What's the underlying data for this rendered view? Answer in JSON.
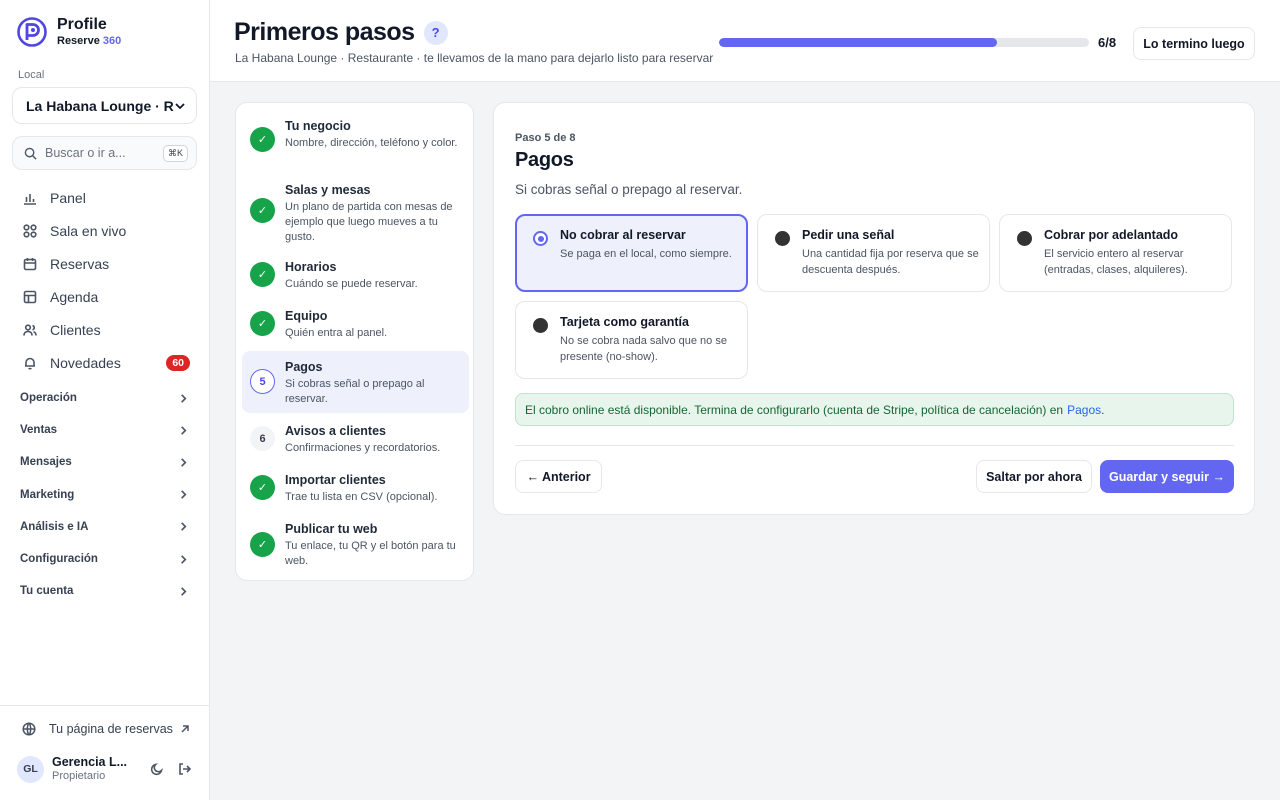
{
  "brand": {
    "name": "Profile",
    "product": "Reserve",
    "version": "360"
  },
  "sidebar": {
    "local_label": "Local",
    "local_value": "La Habana Lounge · Restaurante",
    "search_placeholder": "Buscar o ir a...",
    "search_shortcut": "⌘K",
    "nav": [
      {
        "label": "Panel",
        "icon": "bar-chart-icon"
      },
      {
        "label": "Sala en vivo",
        "icon": "grid-icon"
      },
      {
        "label": "Reservas",
        "icon": "calendar-icon"
      },
      {
        "label": "Agenda",
        "icon": "table-icon"
      },
      {
        "label": "Clientes",
        "icon": "users-icon"
      },
      {
        "label": "Novedades",
        "icon": "bell-icon",
        "badge": "60"
      }
    ],
    "groups": [
      "Operación",
      "Ventas",
      "Mensajes",
      "Marketing",
      "Análisis e IA",
      "Configuración",
      "Tu cuenta"
    ],
    "web_link": "Tu página de reservas",
    "user": {
      "initials": "GL",
      "name": "Gerencia L...",
      "role": "Propietario"
    }
  },
  "header": {
    "title": "Primeros pasos",
    "help": "?",
    "subtitle": "La Habana Lounge · Restaurante · te llevamos de la mano para dejarlo listo para reservar",
    "progress": 0.75,
    "progress_label": "6/8",
    "later_button": "Lo termino luego"
  },
  "steps": [
    {
      "status": "done",
      "marker": "✓",
      "title": "Tu negocio",
      "desc": "Nombre, dirección, teléfono y color."
    },
    {
      "status": "done",
      "marker": "✓",
      "title": "Salas y mesas",
      "desc": "Un plano de partida con mesas de ejemplo que luego mueves a tu gusto."
    },
    {
      "status": "done",
      "marker": "✓",
      "title": "Horarios",
      "desc": "Cuándo se puede reservar."
    },
    {
      "status": "done",
      "marker": "✓",
      "title": "Equipo",
      "desc": "Quién entra al panel."
    },
    {
      "status": "current",
      "marker": "5",
      "title": "Pagos",
      "desc": "Si cobras señal o prepago al reservar."
    },
    {
      "status": "pending",
      "marker": "6",
      "title": "Avisos a clientes",
      "desc": "Confirmaciones y recordatorios."
    },
    {
      "status": "done",
      "marker": "✓",
      "title": "Importar clientes",
      "desc": "Trae tu lista en CSV (opcional)."
    },
    {
      "status": "done",
      "marker": "✓",
      "title": "Publicar tu web",
      "desc": "Tu enlace, tu QR y el botón para tu web."
    }
  ],
  "card": {
    "step_counter": "Paso 5 de 8",
    "title": "Pagos",
    "desc": "Si cobras señal o prepago al reservar.",
    "options": [
      {
        "title": "No cobrar al reservar",
        "desc": "Se paga en el local, como siempre.",
        "selected": true
      },
      {
        "title": "Pedir una señal",
        "desc": "Una cantidad fija por reserva que se descuenta después.",
        "selected": false
      },
      {
        "title": "Cobrar por adelantado",
        "desc": "El servicio entero al reservar (entradas, clases, alquileres).",
        "selected": false
      },
      {
        "title": "Tarjeta como garantía",
        "desc": "No se cobra nada salvo que no se presente (no-show).",
        "selected": false
      }
    ],
    "notice_text": "El cobro online está disponible. Termina de configurarlo (cuenta de Stripe, política de cancelación) en",
    "notice_link": "Pagos",
    "notice_end": ".",
    "prev_button": "← Anterior",
    "skip_button": "Saltar por ahora",
    "save_button": "Guardar y seguir →"
  },
  "colors": {
    "accent": "#6366f1",
    "done": "#16a34a",
    "badge": "#dc2626",
    "notice_bg": "#e8f5ec"
  }
}
